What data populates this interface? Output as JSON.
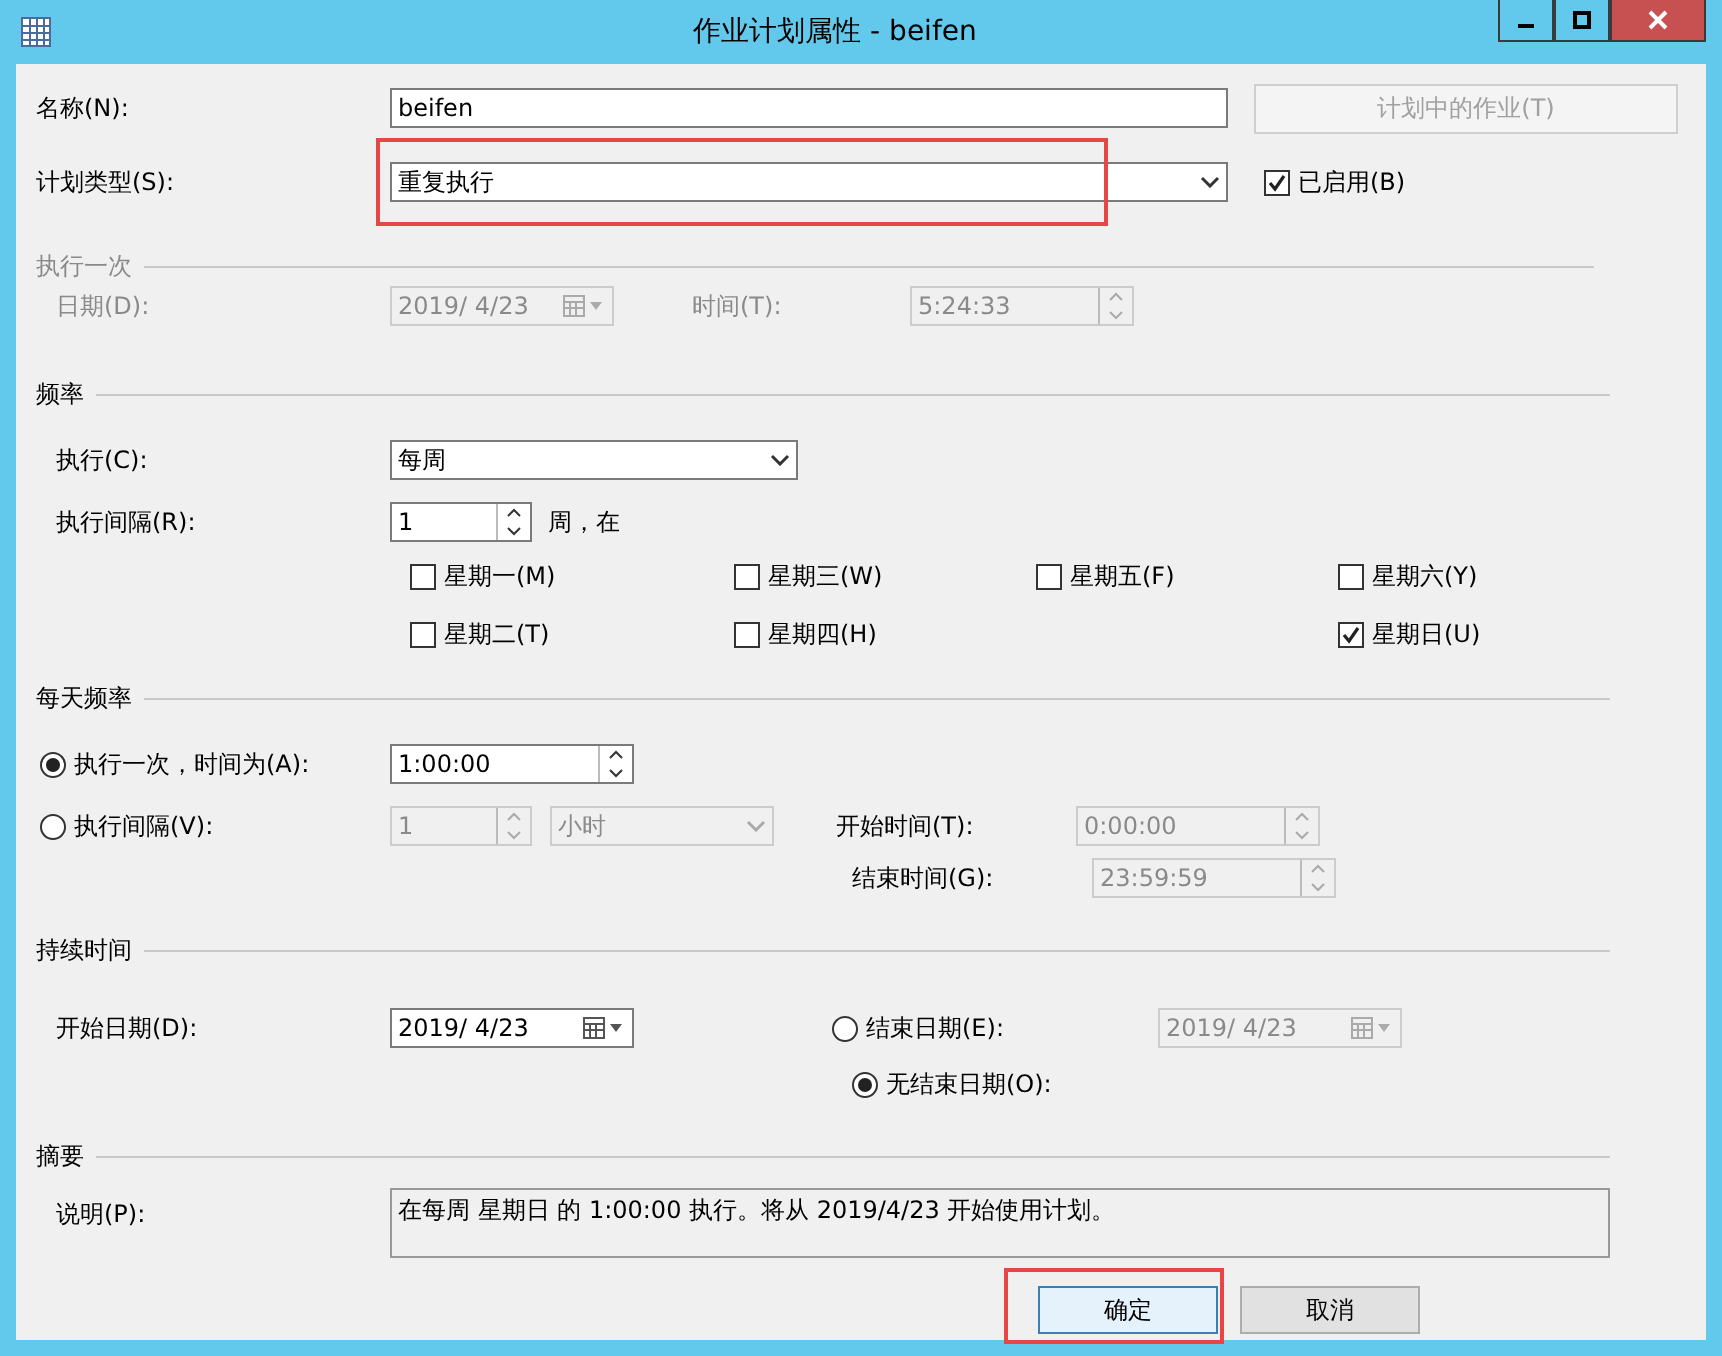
{
  "window": {
    "title": "作业计划属性 - beifen"
  },
  "name": {
    "label": "名称(N):",
    "value": "beifen"
  },
  "jobs_button": {
    "label": "计划中的作业(T)",
    "disabled": true
  },
  "schedule_type": {
    "label": "计划类型(S):",
    "value": "重复执行",
    "highlighted": true
  },
  "enabled": {
    "label": "已启用(B)",
    "checked": true
  },
  "one_time": {
    "title": "执行一次",
    "disabled": true,
    "date_label": "日期(D):",
    "date": "2019/ 4/23",
    "time_label": "时间(T):",
    "time": "5:24:33"
  },
  "frequency": {
    "title": "频率",
    "occurs_label": "执行(C):",
    "occurs": "每周",
    "recurs_label": "执行间隔(R):",
    "recurs": "1",
    "recurs_unit": "周，在",
    "day_columns": [
      [
        {
          "label": "星期一(M)",
          "checked": false
        },
        {
          "label": "星期二(T)",
          "checked": false
        }
      ],
      [
        {
          "label": "星期三(W)",
          "checked": false
        },
        {
          "label": "星期四(H)",
          "checked": false
        }
      ],
      [
        {
          "label": "星期五(F)",
          "checked": false
        }
      ],
      [
        {
          "label": "星期六(Y)",
          "checked": false
        },
        {
          "label": "星期日(U)",
          "checked": true
        }
      ]
    ]
  },
  "daily": {
    "title": "每天频率",
    "options": [
      {
        "kind": "once",
        "label": "执行一次，时间为(A):",
        "selected": true,
        "time": "1:00:00"
      },
      {
        "kind": "interval",
        "label": "执行间隔(V):",
        "selected": false,
        "every": "1",
        "unit": "小时",
        "start_label": "开始时间(T):",
        "start": "0:00:00",
        "end_label": "结束时间(G):",
        "end": "23:59:59"
      }
    ]
  },
  "duration": {
    "title": "持续时间",
    "start_label": "开始日期(D):",
    "start": "2019/ 4/23",
    "end_options": [
      {
        "kind": "end_date",
        "label": "结束日期(E):",
        "selected": false,
        "date": "2019/ 4/23"
      },
      {
        "kind": "no_end",
        "label": "无结束日期(O):",
        "selected": true
      }
    ]
  },
  "summary": {
    "title": "摘要",
    "label": "说明(P):",
    "text": "在每周 星期日 的 1:00:00 执行。将从 2019/4/23 开始使用计划。"
  },
  "buttons": [
    {
      "label": "确定",
      "highlighted": true
    },
    {
      "label": "取消",
      "highlighted": false
    }
  ]
}
